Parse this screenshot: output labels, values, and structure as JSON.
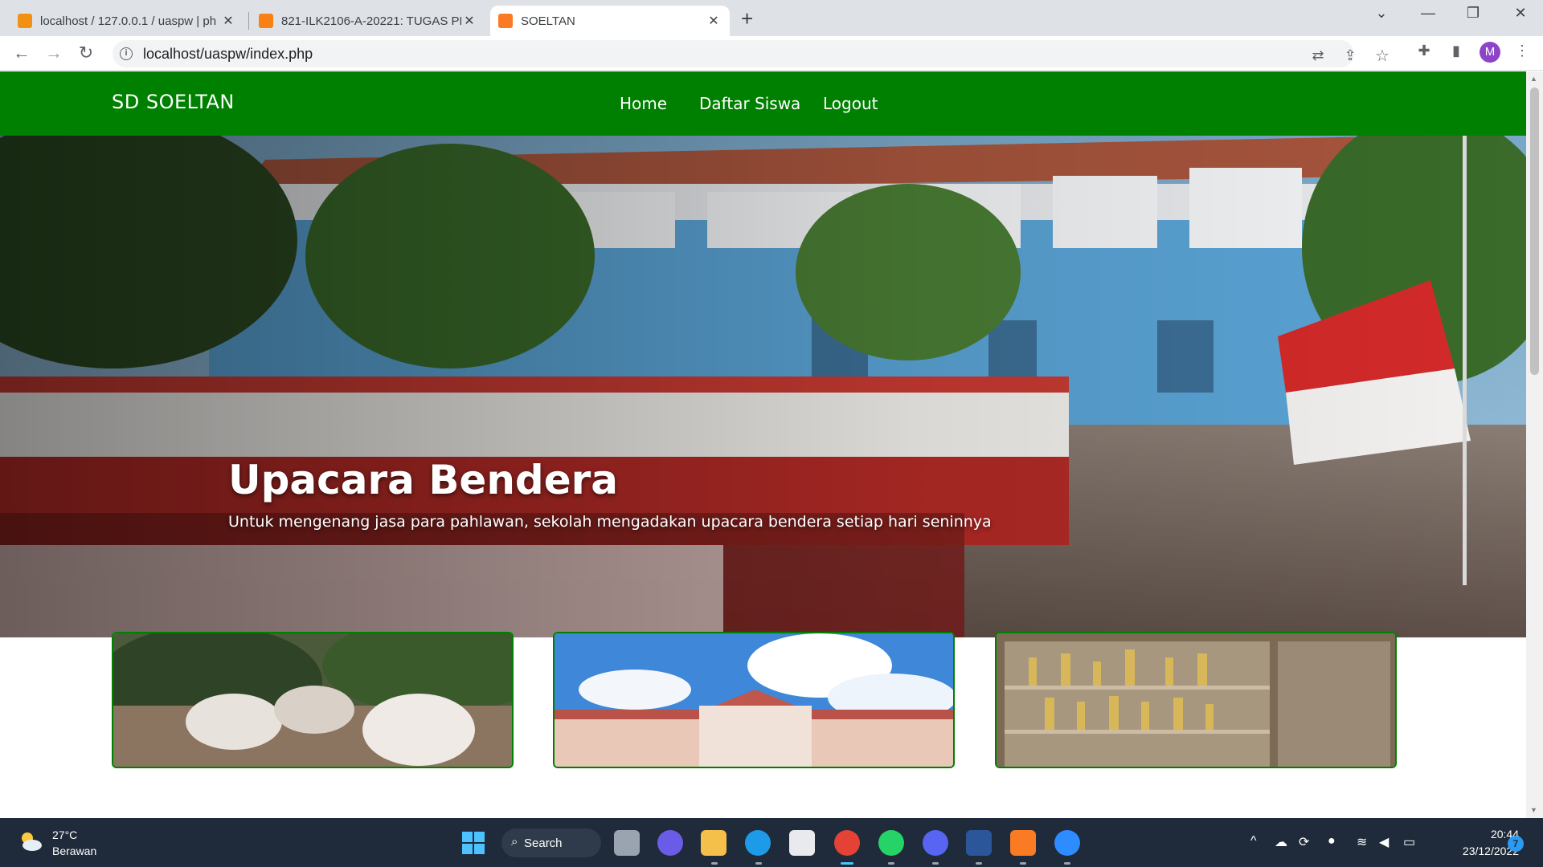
{
  "browser": {
    "tabs": [
      {
        "title": "localhost / 127.0.0.1 / uaspw | ph",
        "active": false
      },
      {
        "title": "821-ILK2106-A-20221: TUGAS PE",
        "active": false
      },
      {
        "title": "SOELTAN",
        "active": true
      }
    ],
    "url": "localhost/uaspw/index.php",
    "profile_initial": "M",
    "icons": {
      "back": "arrow-left-icon",
      "forward": "arrow-right-icon",
      "reload": "reload-icon",
      "translate": "translate-icon",
      "share": "share-icon",
      "bookmark": "star-icon",
      "extensions": "puzzle-icon",
      "sidepanel": "sidepanel-icon",
      "menu": "kebab-menu-icon"
    }
  },
  "site": {
    "brand": "SD SOELTAN",
    "nav": [
      "Home",
      "Daftar Siswa",
      "Logout"
    ],
    "accent_color": "#008000",
    "hero": {
      "title": "Upacara Bendera",
      "subtitle": "Untuk mengenang jasa para pahlawan, sekolah mengadakan upacara bendera setiap hari seninnya"
    }
  },
  "taskbar": {
    "weather": {
      "temp": "27°C",
      "desc": "Berawan"
    },
    "search_label": "Search",
    "time": "20:44",
    "date": "23/12/2022",
    "notification_count": "7"
  }
}
